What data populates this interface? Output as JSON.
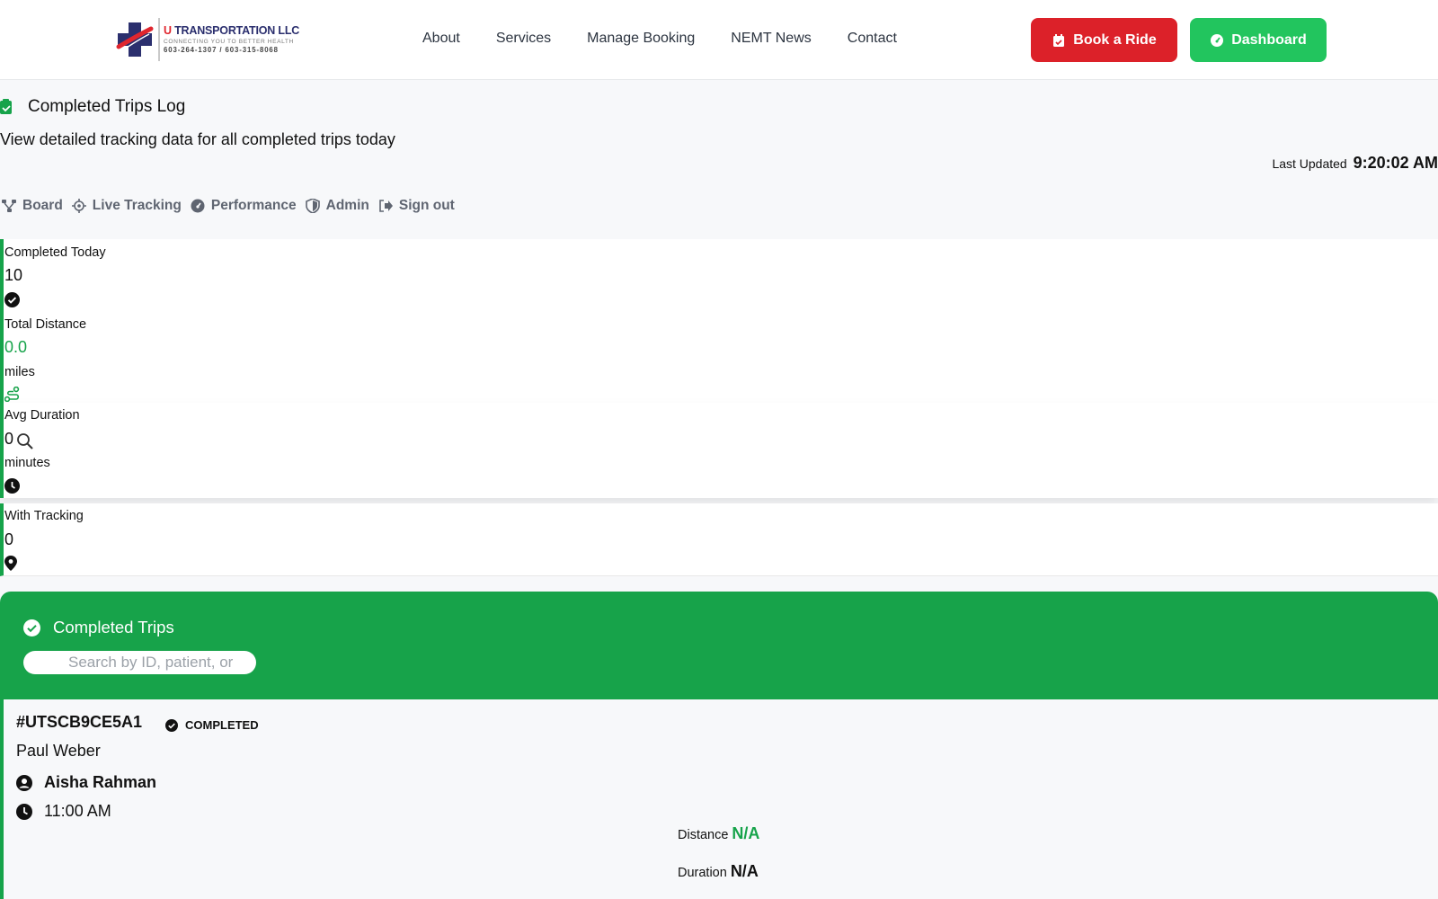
{
  "brand": {
    "name_prefix": "U",
    "name_rest": " TRANSPORTATION LLC",
    "tagline": "CONNECTING YOU TO BETTER HEALTH",
    "phones": "603-264-1307 / 603-315-8068"
  },
  "nav": {
    "items": [
      {
        "label": "About"
      },
      {
        "label": "Services"
      },
      {
        "label": "Manage Booking"
      },
      {
        "label": "NEMT News"
      },
      {
        "label": "Contact"
      }
    ]
  },
  "header_buttons": {
    "book": "Book a Ride",
    "dashboard": "Dashboard"
  },
  "page": {
    "title": "Completed Trips Log",
    "subtitle": "View detailed tracking data for all completed trips today",
    "last_updated_label": "Last Updated",
    "last_updated_time": "9:20:02 AM"
  },
  "subnav": {
    "items": [
      {
        "label": "Board",
        "icon": "network-icon"
      },
      {
        "label": "Live Tracking",
        "icon": "crosshair-icon"
      },
      {
        "label": "Performance",
        "icon": "gauge-icon"
      },
      {
        "label": "Admin",
        "icon": "shield-icon"
      },
      {
        "label": "Sign out",
        "icon": "sign-out-icon"
      }
    ]
  },
  "stats": {
    "completed_today": {
      "label": "Completed Today",
      "value": "10"
    },
    "total_distance": {
      "label": "Total Distance",
      "value": "0.0",
      "unit": "miles"
    },
    "avg_duration": {
      "label": "Avg Duration",
      "value": "0",
      "unit": "minutes"
    },
    "with_tracking": {
      "label": "With Tracking",
      "value": "0"
    }
  },
  "trips_panel": {
    "title": "Completed Trips",
    "search_placeholder": "Search by ID, patient, or"
  },
  "trips": [
    {
      "id": "#UTSCB9CE5A1",
      "status": "COMPLETED",
      "pickup": "Paul Weber",
      "driver": "Aisha Rahman",
      "time": "11:00 AM",
      "distance_label": "Distance",
      "distance_value": "N/A",
      "duration_label": "Duration",
      "duration_value": "N/A"
    }
  ],
  "colors": {
    "primary_green": "#16a34a",
    "dashboard_green": "#22c55e",
    "book_red": "#dc2129",
    "navy": "#2b2f6e"
  }
}
